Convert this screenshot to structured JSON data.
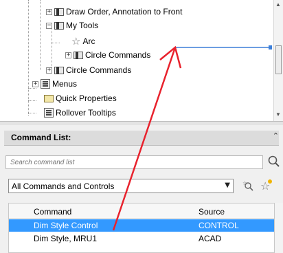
{
  "tree": {
    "items": [
      {
        "label": "Draw Order, Annotation to Front",
        "expander": "+"
      },
      {
        "label": "My Tools",
        "expander": "−"
      },
      {
        "label": "Arc"
      },
      {
        "label": "Circle Commands",
        "expander": "+"
      },
      {
        "label": "Circle Commands",
        "expander": "+"
      },
      {
        "label": "Menus",
        "expander": "+"
      },
      {
        "label": "Quick Properties"
      },
      {
        "label": "Rollover Tooltips"
      }
    ]
  },
  "command_list": {
    "title": "Command List:",
    "collapse_glyph": "⌃",
    "search_placeholder": "Search command list",
    "filter_value": "All Commands and Controls",
    "columns": {
      "command": "Command",
      "source": "Source"
    },
    "rows": [
      {
        "command": "Dim Style Control",
        "source": "CONTROL",
        "selected": true
      },
      {
        "command": "Dim Style, MRU1",
        "source": "ACAD",
        "selected": false
      }
    ]
  },
  "colors": {
    "selection": "#3399ff",
    "annotation_arrow": "#e8222d",
    "drop_indicator": "#3d7fd9"
  },
  "icons": {
    "search": "magnifier-icon",
    "find": "find-command-icon",
    "new": "new-command-icon"
  }
}
